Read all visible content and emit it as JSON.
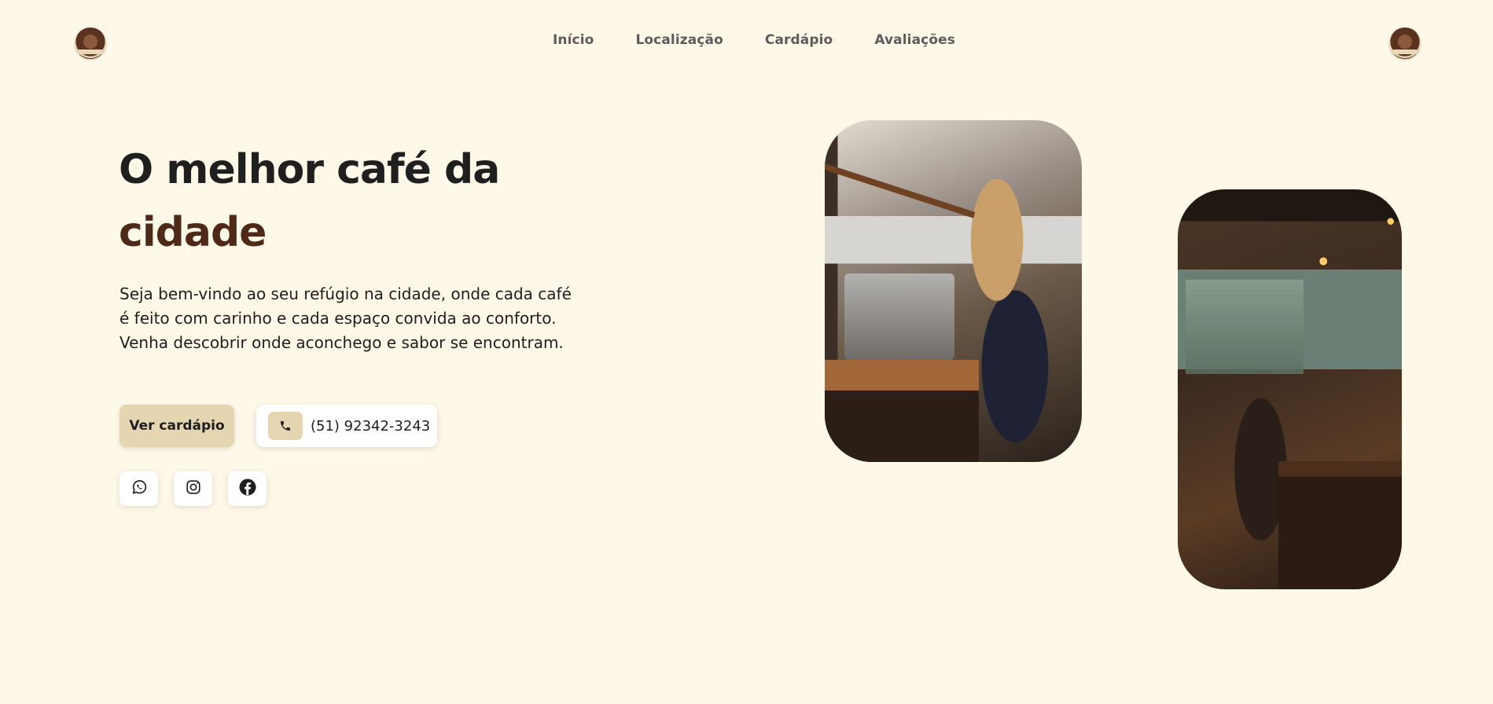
{
  "nav": {
    "items": [
      {
        "label": "Início"
      },
      {
        "label": "Localização"
      },
      {
        "label": "Cardápio"
      },
      {
        "label": "Avaliações"
      }
    ]
  },
  "hero": {
    "title_line1": "O melhor café da",
    "title_line2": "cidade",
    "description": "Seja bem-vindo ao seu refúgio na cidade, onde cada café é feito com carinho e cada espaço convida ao conforto. Venha descobrir onde aconchego e sabor se encontram.",
    "menu_button": "Ver cardápio",
    "phone": "(51) 92342-3243"
  },
  "socials": [
    {
      "icon": "whatsapp-icon"
    },
    {
      "icon": "instagram-icon"
    },
    {
      "icon": "facebook-icon"
    }
  ],
  "colors": {
    "background": "#fef8e8",
    "accent": "#4e2917",
    "button": "#e5d5b1"
  }
}
